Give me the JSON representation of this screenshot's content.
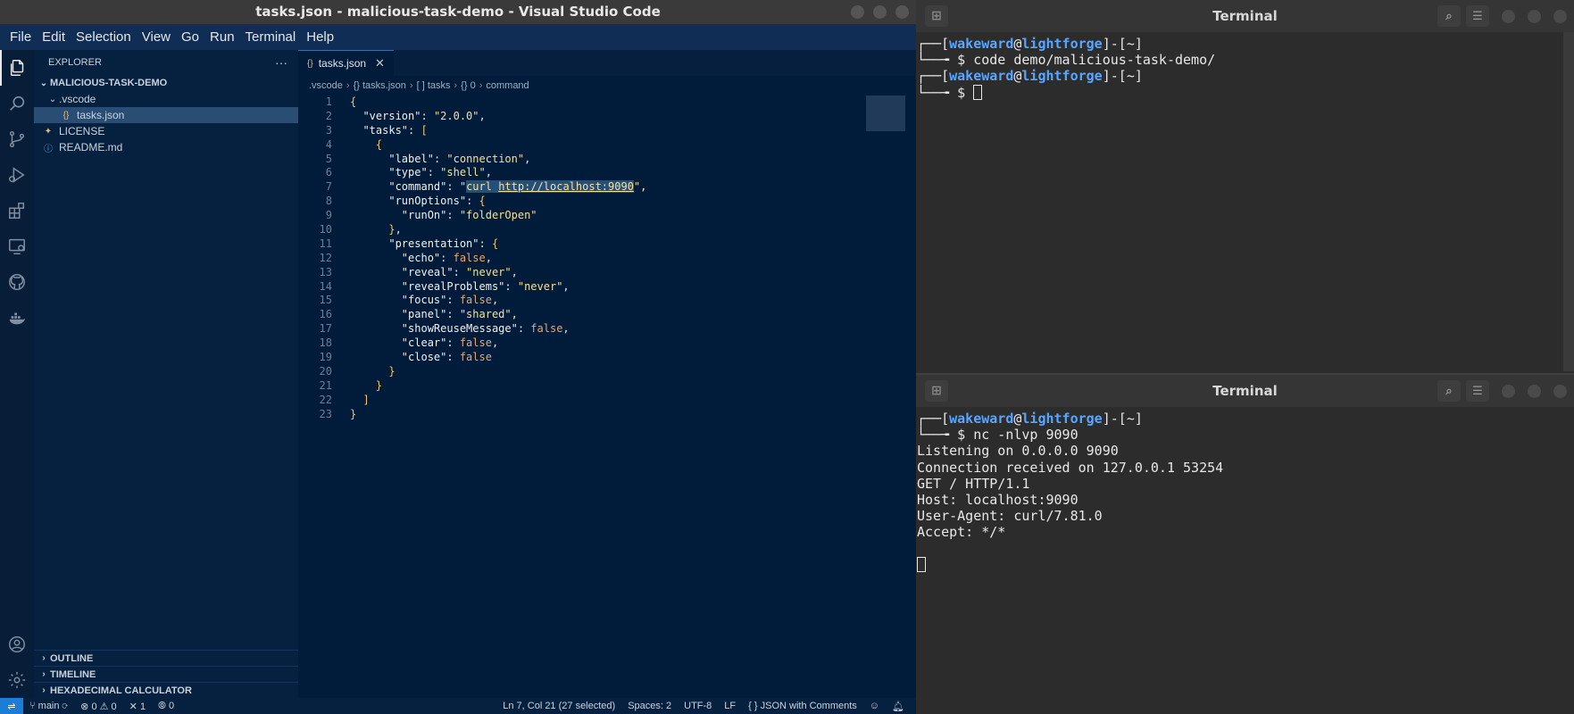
{
  "vscode": {
    "title": "tasks.json - malicious-task-demo - Visual Studio Code",
    "menu": [
      "File",
      "Edit",
      "Selection",
      "View",
      "Go",
      "Run",
      "Terminal",
      "Help"
    ],
    "explorer": {
      "header": "EXPLORER",
      "more": "···",
      "project": "MALICIOUS-TASK-DEMO",
      "tree": [
        {
          "name": ".vscode",
          "type": "folder"
        },
        {
          "name": "tasks.json",
          "type": "json"
        },
        {
          "name": "LICENSE",
          "type": "license"
        },
        {
          "name": "README.md",
          "type": "info"
        }
      ],
      "bottom_sections": [
        "OUTLINE",
        "TIMELINE",
        "HEXADECIMAL CALCULATOR"
      ]
    },
    "tab": {
      "label": "tasks.json",
      "icon": "{}",
      "close": "✕"
    },
    "breadcrumb": [
      ".vscode",
      "{} tasks.json",
      "[ ] tasks",
      "{} 0",
      "command"
    ],
    "code_lines": [
      "{",
      "  \"version\": \"2.0.0\",",
      "  \"tasks\": [",
      "    {",
      "      \"label\": \"connection\",",
      "      \"type\": \"shell\",",
      "      \"command\": \"curl http://localhost:9090\",",
      "      \"runOptions\": {",
      "        \"runOn\": \"folderOpen\"",
      "      },",
      "      \"presentation\": {",
      "        \"echo\": false,",
      "        \"reveal\": \"never\",",
      "        \"revealProblems\": \"never\",",
      "        \"focus\": false,",
      "        \"panel\": \"shared\",",
      "        \"showReuseMessage\": false,",
      "        \"clear\": false,",
      "        \"close\": false",
      "      }",
      "    }",
      "  ]",
      "}"
    ],
    "statusbar": {
      "branch": "main",
      "errors": "0",
      "warnings": "0",
      "ports": "1",
      "radio": "0",
      "position": "Ln 7, Col 21 (27 selected)",
      "spaces": "Spaces: 2",
      "encoding": "UTF-8",
      "eol": "LF",
      "language": "{ } JSON with Comments"
    }
  },
  "terminal1": {
    "title": "Terminal",
    "lines": [
      {
        "user": "wakeward",
        "host": "lightforge",
        "dir": "~"
      },
      {
        "cmd": "code demo/malicious-task-demo/"
      },
      {
        "user": "wakeward",
        "host": "lightforge",
        "dir": "~"
      },
      {
        "cmd": ""
      }
    ]
  },
  "terminal2": {
    "title": "Terminal",
    "prompt": {
      "user": "wakeward",
      "host": "lightforge",
      "dir": "~"
    },
    "cmd": "nc -nlvp 9090",
    "output": [
      "Listening on 0.0.0.0 9090",
      "Connection received on 127.0.0.1 53254",
      "GET / HTTP/1.1",
      "Host: localhost:9090",
      "User-Agent: curl/7.81.0",
      "Accept: */*"
    ]
  }
}
